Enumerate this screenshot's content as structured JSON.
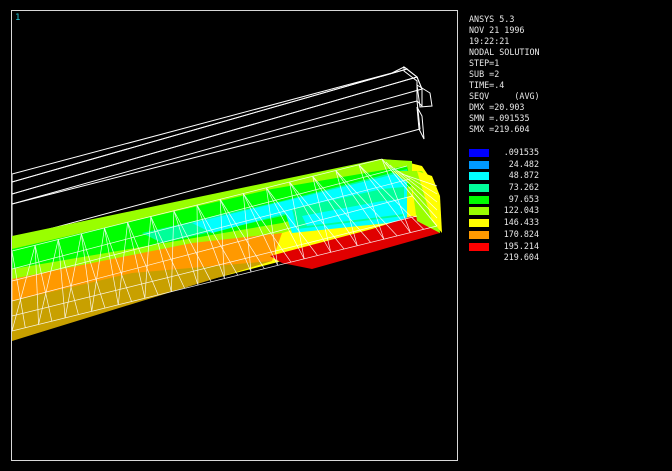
{
  "window": {
    "number": "1"
  },
  "info_panel": {
    "lines": [
      "ANSYS 5.3",
      "NOV 21 1996",
      "19:22:21",
      "NODAL SOLUTION",
      "STEP=1",
      "SUB =2",
      "TIME=.4",
      "SEQV     (AVG)",
      "DMX =20.903",
      "SMN =.091535",
      "SMX =219.604"
    ]
  },
  "legend": {
    "entries": [
      {
        "value": ".091535",
        "color": "#0000ff"
      },
      {
        "value": "24.482",
        "color": "#0099ff"
      },
      {
        "value": "48.872",
        "color": "#00ffff"
      },
      {
        "value": "73.262",
        "color": "#00ff99"
      },
      {
        "value": "97.653",
        "color": "#00ff00"
      },
      {
        "value": "122.043",
        "color": "#99ff00"
      },
      {
        "value": "146.433",
        "color": "#ffff00"
      },
      {
        "value": "170.824",
        "color": "#ff9900"
      },
      {
        "value": "195.214",
        "color": "#ff0000"
      },
      {
        "value": "219.604",
        "color": "#ff0000"
      }
    ]
  },
  "colors": {
    "background": "#000000",
    "frame": "#d8d8d8",
    "mesh_lines": "#ffffff",
    "window_number": "#26c6d6"
  }
}
